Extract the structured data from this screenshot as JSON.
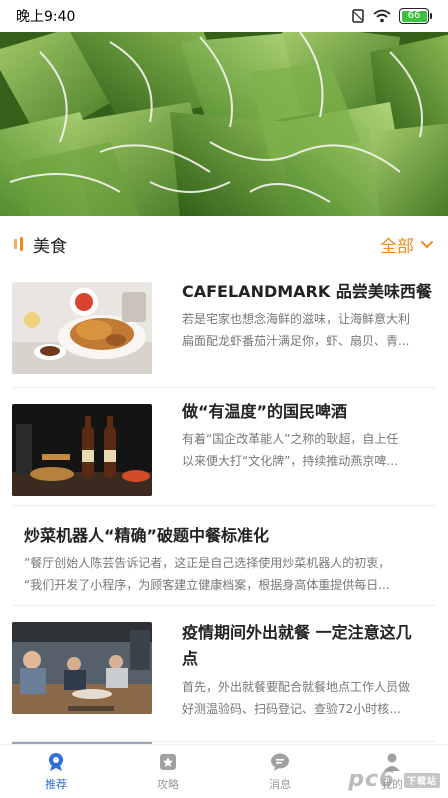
{
  "status": {
    "time": "晚上9:40",
    "battery": "66"
  },
  "section": {
    "title": "美食",
    "more_label": "全部"
  },
  "articles": [
    {
      "title": "CAFELANDMARK 品尝美味西餐",
      "desc1": "若是宅家也想念海鲜的滋味，让海鲜意大利",
      "desc2": "扁面配龙虾番茄汁满足你，虾、扇贝、青..."
    },
    {
      "title": "做“有温度”的国民啤酒",
      "desc1": "有着“国企改革能人”之称的耿超，自上任",
      "desc2": "以来便大打“文化牌”，持续推动燕京啤..."
    },
    {
      "title": "炒菜机器人“精确”破题中餐标准化",
      "desc1": "”餐厅创始人陈芸告诉记者，这正是自己选择使用炒菜机器人的初衷，",
      "desc2": "“我们开发了小程序，为顾客建立健康档案，根据身高体重提供每日..."
    },
    {
      "title": "疫情期间外出就餐 一定注意这几",
      "title2": "点",
      "desc1": "首先，外出就餐要配合就餐地点工作人员做",
      "desc2": "好测温验码、扫码登记、查验72小时核..."
    }
  ],
  "tabs": [
    {
      "label": "推荐",
      "icon": "recommend-icon"
    },
    {
      "label": "攻略",
      "icon": "guide-icon"
    },
    {
      "label": "消息",
      "icon": "message-icon"
    },
    {
      "label": "我的",
      "icon": "profile-icon"
    }
  ],
  "watermark": {
    "text": "pc6",
    "sub": "下载站"
  },
  "colors": {
    "accent": "#f08a1c",
    "tab_active": "#2f6fd8"
  }
}
